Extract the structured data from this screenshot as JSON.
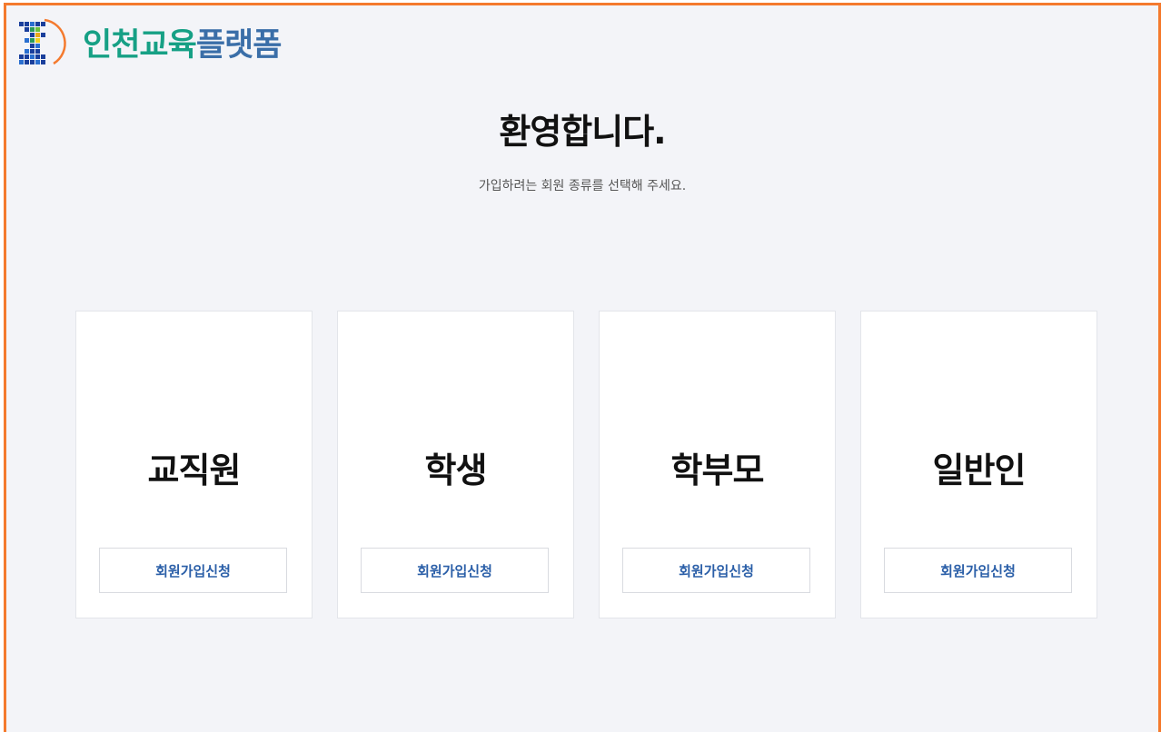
{
  "brand": {
    "name_part1": "인천교육",
    "name_part2": "플랫폼",
    "logo_icon": "incheon-education-logo-icon",
    "colors": {
      "green": "#16a085",
      "blue": "#3a6ea8",
      "orange": "#f47a2e"
    }
  },
  "page": {
    "title": "환영합니다.",
    "subtitle": "가입하려는 회원 종류를 선택해 주세요."
  },
  "cards": [
    {
      "label": "교직원",
      "button": "회원가입신청"
    },
    {
      "label": "학생",
      "button": "회원가입신청"
    },
    {
      "label": "학부모",
      "button": "회원가입신청"
    },
    {
      "label": "일반인",
      "button": "회원가입신청"
    }
  ]
}
